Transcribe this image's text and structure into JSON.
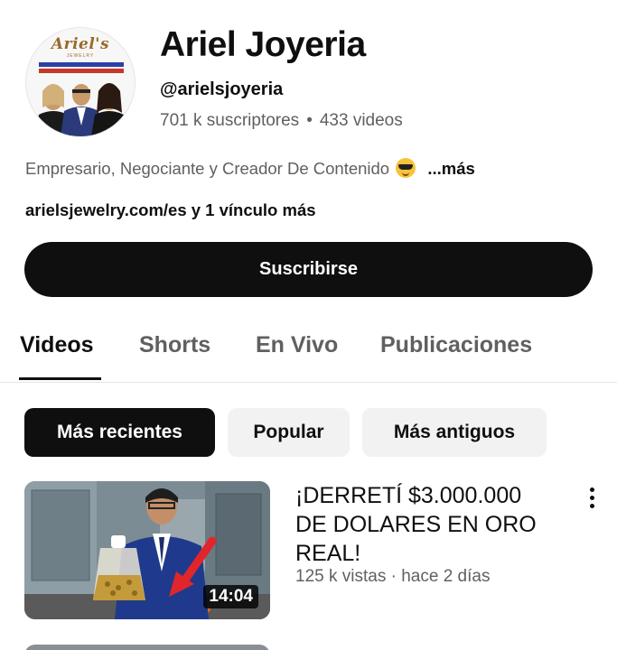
{
  "channel": {
    "avatar": {
      "logo_text": "Ariel's",
      "logo_sub": "JEWELRY"
    },
    "name": "Ariel Joyeria",
    "handle": "@arielsjoyeria",
    "subscribers": "701 k suscriptores",
    "separator": "•",
    "videos_count": "433 videos",
    "description": "Empresario, Negociante y Creador De Contenido",
    "description_emoji": "smiling-face-with-sunglasses-icon",
    "more_label": "...más",
    "links": "arielsjewelry.com/es y 1 vínculo más",
    "subscribe_label": "Suscribirse"
  },
  "tabs": [
    {
      "label": "Videos",
      "active": true
    },
    {
      "label": "Shorts",
      "active": false
    },
    {
      "label": "En Vivo",
      "active": false
    },
    {
      "label": "Publicaciones",
      "active": false
    }
  ],
  "filters": [
    {
      "label": "Más recientes",
      "active": true
    },
    {
      "label": "Popular",
      "active": false
    },
    {
      "label": "Más antiguos",
      "active": false
    }
  ],
  "videos": [
    {
      "title": "¡DERRETÍ $3.000.000 DE DOLARES EN ORO REAL!",
      "meta": "125 k vistas · hace 2 días",
      "duration": "14:04",
      "menu_icon": "more-vert-icon"
    }
  ],
  "colors": {
    "primary_text": "#0f0f0f",
    "secondary_text": "#606060",
    "chip_bg": "#f2f2f2",
    "arrow_red": "#e0262a"
  }
}
